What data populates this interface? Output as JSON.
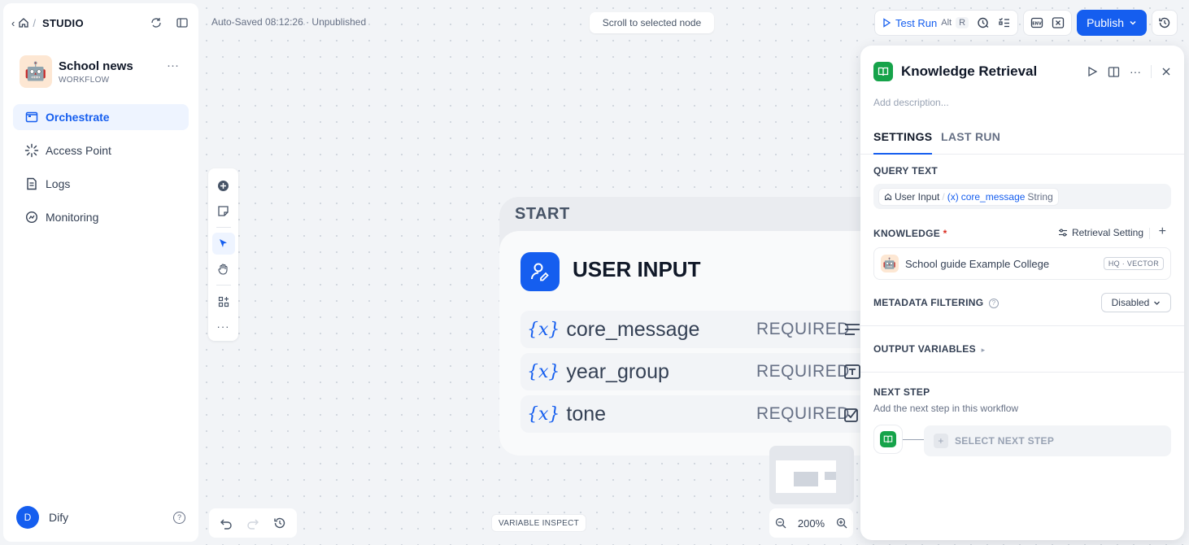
{
  "breadcrumb": {
    "section": "STUDIO"
  },
  "app": {
    "name": "School news",
    "type": "WORKFLOW",
    "avatar": "🤖"
  },
  "nav": {
    "items": [
      {
        "label": "Orchestrate",
        "icon": "orchestrate-icon",
        "active": true
      },
      {
        "label": "Access Point",
        "icon": "access-point-icon",
        "active": false
      },
      {
        "label": "Logs",
        "icon": "logs-icon",
        "active": false
      },
      {
        "label": "Monitoring",
        "icon": "monitoring-icon",
        "active": false
      }
    ]
  },
  "user": {
    "initial": "D",
    "name": "Dify"
  },
  "header": {
    "autosave": "Auto-Saved 08:12:26 · Unpublished",
    "scroll_btn": "Scroll to selected node",
    "test_run": "Test Run",
    "shortcut_alt": "Alt",
    "shortcut_key": "R",
    "publish": "Publish"
  },
  "canvas": {
    "variable_inspect": "VARIABLE INSPECT",
    "zoom": "200%"
  },
  "start_node": {
    "label": "START",
    "title": "USER INPUT",
    "variables": [
      {
        "name": "core_message",
        "status": "REQUIRED",
        "icon": "paragraph-icon"
      },
      {
        "name": "year_group",
        "status": "REQUIRED",
        "icon": "text-input-icon"
      },
      {
        "name": "tone",
        "status": "REQUIRED",
        "icon": "checkbox-icon"
      }
    ],
    "var_symbol": "{x}"
  },
  "panel": {
    "title": "Knowledge Retrieval",
    "description_placeholder": "Add description...",
    "tabs": [
      "SETTINGS",
      "LAST RUN"
    ],
    "query_text_label": "QUERY TEXT",
    "query": {
      "source": "User Input",
      "separator": "/",
      "var_symbol": "(x)",
      "variable": "core_message",
      "type": "String"
    },
    "knowledge_label": "KNOWLEDGE",
    "required_mark": "*",
    "retrieval_setting": "Retrieval Setting",
    "knowledge_item": {
      "avatar": "🤖",
      "name": "School guide Example College",
      "badge": "HQ · VECTOR"
    },
    "metadata_label": "METADATA FILTERING",
    "metadata_value": "Disabled",
    "output_label": "OUTPUT VARIABLES",
    "next_step_label": "NEXT STEP",
    "next_step_sub": "Add the next step in this workflow",
    "select_next": "SELECT NEXT STEP"
  },
  "colors": {
    "accent": "#155eef",
    "knowledge_green": "#16a34a"
  }
}
